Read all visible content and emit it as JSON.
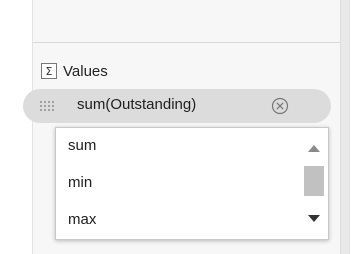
{
  "values_section": {
    "label": "Values",
    "icon": "sigma-icon"
  },
  "field_pill": {
    "label": "sum(Outstanding)",
    "grip_icon": "grip-icon",
    "remove_icon": "remove-circle-icon"
  },
  "aggregation_dropdown": {
    "options": [
      "sum",
      "min",
      "max"
    ]
  },
  "colors": {
    "panel_bg": "#f7f7f7",
    "pill_bg": "#dcdcdc",
    "text": "#1e1e1e"
  }
}
